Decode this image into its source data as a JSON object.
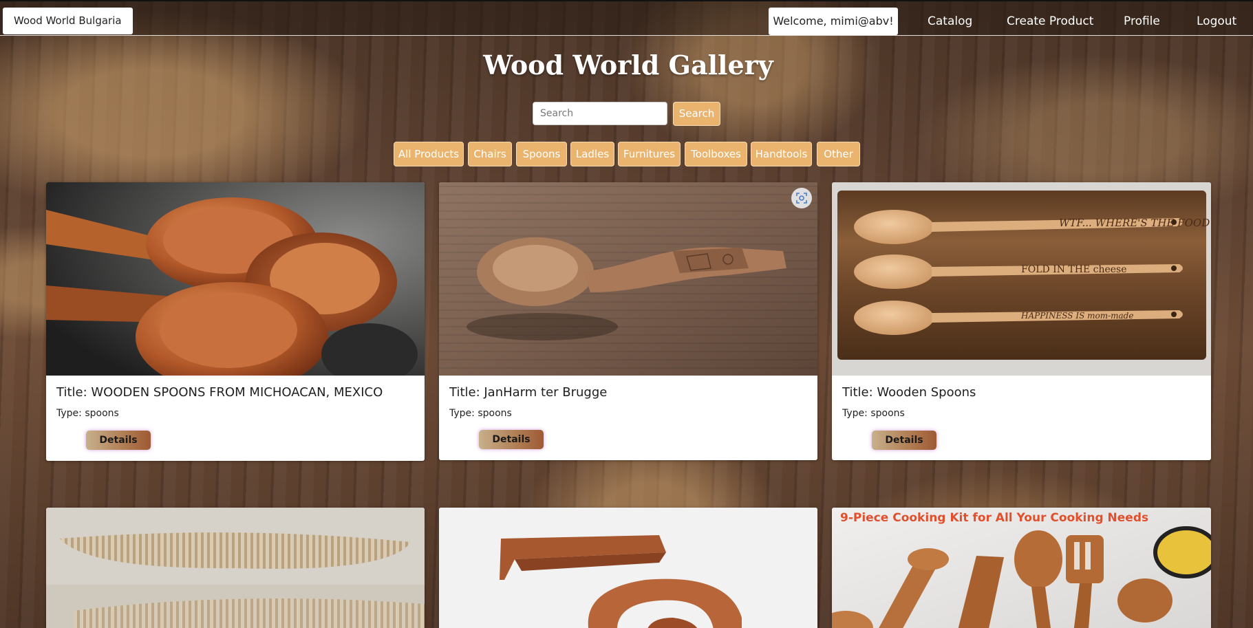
{
  "nav": {
    "brand": "Wood World Bulgaria",
    "welcome": "Welcome, mimi@abv!",
    "links": [
      "Catalog",
      "Create Product",
      "Profile",
      "Logout"
    ]
  },
  "header": {
    "title": "Wood World Gallery",
    "search_placeholder": "Search",
    "search_button": "Search",
    "categories": [
      "All Products",
      "Chairs",
      "Spoons",
      "Ladles",
      "Furnitures",
      "Toolboxes",
      "Handtools",
      "Other"
    ]
  },
  "products": [
    {
      "title": "Title: WOODEN SPOONS FROM MICHOACAN, MEXICO",
      "type": "Type: spoons",
      "details": "Details"
    },
    {
      "title": "Title: JanHarm ter Brugge",
      "type": "Type: spoons",
      "details": "Details"
    },
    {
      "title": "Title: Wooden Spoons",
      "type": "Type: spoons",
      "details": "Details"
    }
  ],
  "image_texts": {
    "spoon_engravings": [
      "WTF... WHERE'S THE FOOD",
      "FOLD IN THE cheese",
      "HAPPINESS IS mom-made"
    ],
    "kit_banner": "9-Piece Cooking Kit for All Your Cooking Needs"
  },
  "colors": {
    "accent": "#eab46f",
    "accent_border": "#f7dcb6",
    "details_glow": "#ba6ec8"
  }
}
